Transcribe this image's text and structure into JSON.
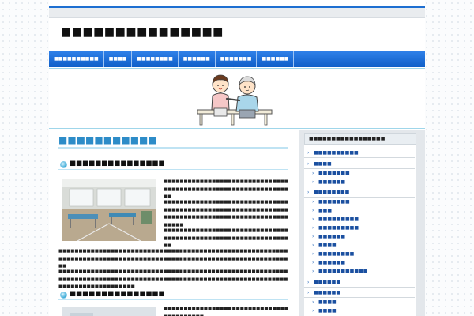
{
  "header": {
    "site_title": "■■■■■■■■■■■■■■■"
  },
  "nav": {
    "items": [
      "■■■■■■■■■■",
      "■■■■",
      "■■■■■■■■",
      "■■■■■■",
      "■■■■■■■",
      "■■■■■■"
    ]
  },
  "main": {
    "heading": "■■■■■■■■■■■",
    "section1_title": "■■■■■■■■■■■■■■■",
    "section2_title": "■■■■■■■■■■■■■■■",
    "para1": "■■■■■■■■■■■■■■■■■■■■■■■■■■■■■■■■■■■■■■■■■■■■■■■■■■■■■■■■■■■■■■■■",
    "para2": "■■■■■■■■■■■■■■■■■■■■■■■■■■■■■■■■■■■■■■■■■■■■■■■■■■■■■■■■■■■■■■■■■■■■■■■■■■■■■■■■■■■■■■■■■■■■■■■■■■",
    "para3": "■■■■■■■■■■■■■■■■■■■■■■■■■■■■■■■■■■■■■■■■■■■■■■■■■■■■■■■■■■■■■■■■",
    "para4": "■■■■■■■■■■■■■■■■■■■■■■■■■■■■■■■■■■■■■■■■■■■■■■■■■■■■■■■■■■■■■■■■■■■■■■■■■■■■■■■■■■■■■■■■■■■■■■■■■■■■■■■■■■■■■■■■■■■■",
    "para5": "■■■■■■■■■■■■■■■■■■■■■■■■■■■■■■■■■■■■■■■■■■■■■■■■■■■■■■■■■■■■■■■■■■■■■■■■■■■■■■■■■■■■■■■■■■■■■■■■■■■■■■■■■■■■■■■■■■■■■■■■■■■■■■■■■■■■■",
    "para6": "■■■■■■■■■■■■■■■■■■■■■■■■■■■■■■■■■■■■■■■■■"
  },
  "sidebar": {
    "title": "■■■■■■■■■■■■■■■■■",
    "cat1": "■■■■■■■■■■",
    "cat2": "■■■■",
    "cat2_sub": [
      "■■■■■■■",
      "■■■■■■"
    ],
    "cat3": "■■■■■■■■",
    "cat3_sub": [
      "■■■■■■■",
      "■■■",
      "■■■■■■■■■",
      "■■■■■■■■■",
      "■■■■■■",
      "■■■■",
      "■■■■■■■■",
      "■■■■■■",
      "■■■■■■■■■■■"
    ],
    "cat4": "■■■■■■",
    "cat5": "■■■■■■",
    "cat5_sub": [
      "■■■■",
      "■■■■"
    ]
  }
}
